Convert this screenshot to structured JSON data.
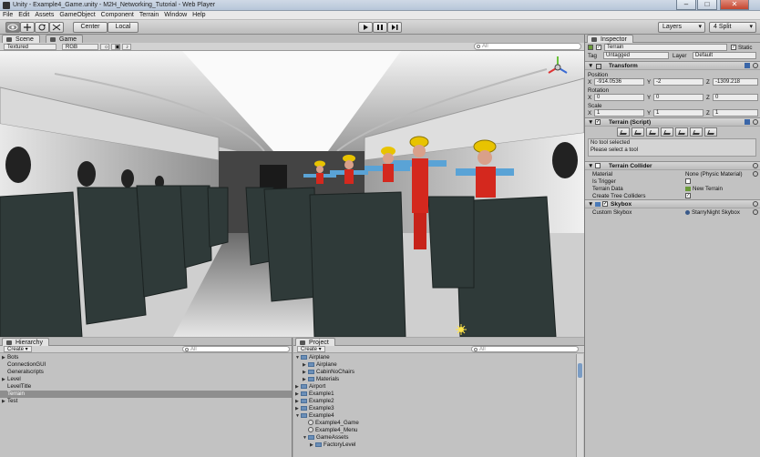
{
  "window": {
    "title": "Unity - Example4_Game.unity - M2H_Networking_Tutorial - Web Player",
    "buttons": {
      "min": "–",
      "max": "□",
      "close": "✕"
    }
  },
  "menu": [
    "File",
    "Edit",
    "Assets",
    "GameObject",
    "Component",
    "Terrain",
    "Window",
    "Help"
  ],
  "toolbar": {
    "pivot": "Center",
    "space": "Local",
    "play_icon": "play-icon",
    "pause_icon": "pause-icon",
    "step_icon": "step-icon",
    "layers": "Layers",
    "layout": "4 Split"
  },
  "scene": {
    "tabs": [
      "Scene",
      "Game"
    ],
    "render_mode": "Textured",
    "color_mode": "RGB",
    "search_placeholder": "All"
  },
  "hierarchy": {
    "title": "Hierarchy",
    "create": "Create",
    "search_placeholder": "All",
    "items": [
      {
        "label": "Bots",
        "expanded": false,
        "indent": 0
      },
      {
        "label": "ConnectionGUI",
        "indent": 1
      },
      {
        "label": "Generalscripts",
        "indent": 1
      },
      {
        "label": "Level",
        "expanded": false,
        "indent": 0
      },
      {
        "label": "LevelTitle",
        "indent": 1
      },
      {
        "label": "Terrain",
        "indent": 1,
        "selected": true
      },
      {
        "label": "Test",
        "expanded": false,
        "indent": 0
      }
    ]
  },
  "project": {
    "title": "Project",
    "create": "Create",
    "search_placeholder": "All",
    "items": [
      {
        "label": "Airplane",
        "type": "folder",
        "expanded": true,
        "indent": 0
      },
      {
        "label": "Airplane",
        "type": "folder",
        "indent": 1
      },
      {
        "label": "CabinNoChairs",
        "type": "folder",
        "indent": 1
      },
      {
        "label": "Materials",
        "type": "folder",
        "indent": 1
      },
      {
        "label": "Airport",
        "type": "folder",
        "indent": 0
      },
      {
        "label": "Example1",
        "type": "folder",
        "indent": 0
      },
      {
        "label": "Example2",
        "type": "folder",
        "indent": 0
      },
      {
        "label": "Example3",
        "type": "folder",
        "indent": 0
      },
      {
        "label": "Example4",
        "type": "folder",
        "expanded": true,
        "indent": 0
      },
      {
        "label": "Example4_Game",
        "type": "scene",
        "indent": 1
      },
      {
        "label": "Example4_Menu",
        "type": "scene",
        "indent": 1
      },
      {
        "label": "GameAssets",
        "type": "folder",
        "expanded": true,
        "indent": 1
      },
      {
        "label": "FactoryLevel",
        "type": "folder",
        "indent": 2
      }
    ]
  },
  "inspector": {
    "title": "Inspector",
    "object_name": "Terrain",
    "static_label": "Static",
    "tag_label": "Tag",
    "tag_value": "Untagged",
    "layer_label": "Layer",
    "layer_value": "Default",
    "transform": {
      "title": "Transform",
      "position_label": "Position",
      "position": {
        "x": "-914.0536",
        "y": "-2",
        "z": "-1309.218"
      },
      "rotation_label": "Rotation",
      "rotation": {
        "x": "0",
        "y": "0",
        "z": "0"
      },
      "scale_label": "Scale",
      "scale": {
        "x": "1",
        "y": "1",
        "z": "1"
      }
    },
    "terrain_script": {
      "title": "Terrain (Script)",
      "status": "No tool selected",
      "hint": "Please select a tool"
    },
    "terrain_collider": {
      "title": "Terrain Collider",
      "material_label": "Material",
      "material_value": "None (Physic Material)",
      "trigger_label": "Is Trigger",
      "data_label": "Terrain Data",
      "data_value": "New Terrain",
      "trees_label": "Create Tree Colliders"
    },
    "skybox": {
      "title": "Skybox",
      "custom_label": "Custom Skybox",
      "custom_value": "StarryNight Skybox"
    }
  },
  "colors": {
    "chrome": "#c2c2c2",
    "selection": "#8e8e8e",
    "accent": "#3a66a8"
  }
}
